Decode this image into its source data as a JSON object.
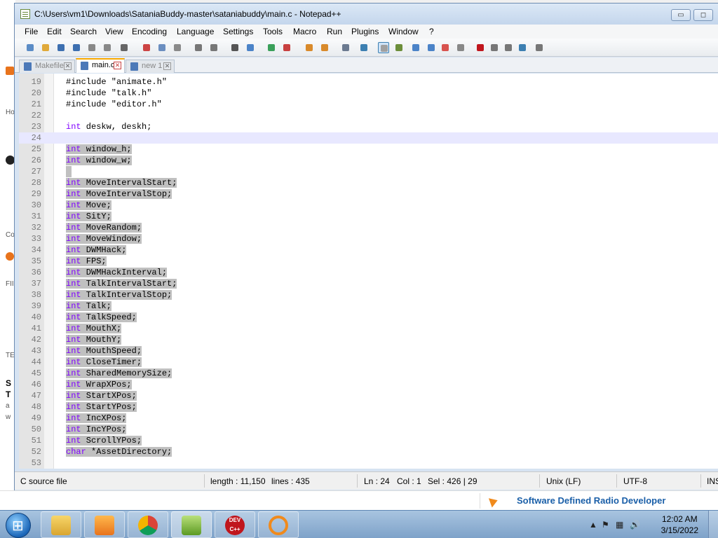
{
  "window": {
    "title": "C:\\Users\\vm1\\Downloads\\SataniaBuddy-master\\sataniabuddy\\main.c - Notepad++",
    "minimize": "▭",
    "maximize": "◻"
  },
  "menu": [
    "File",
    "Edit",
    "Search",
    "View",
    "Encoding",
    "Language",
    "Settings",
    "Tools",
    "Macro",
    "Run",
    "Plugins",
    "Window",
    "?"
  ],
  "toolbar_icons": [
    "new-file-icon",
    "open-file-icon",
    "save-icon",
    "save-all-icon",
    "close-icon",
    "close-all-icon",
    "print-icon",
    "cut-icon",
    "copy-icon",
    "paste-icon",
    "undo-icon",
    "redo-icon",
    "find-icon",
    "replace-icon",
    "zoom-in-icon",
    "zoom-out-icon",
    "sync-v-icon",
    "sync-h-icon",
    "word-wrap-icon",
    "show-all-chars-icon",
    "indent-guide-icon",
    "udl-icon",
    "doc-map-icon",
    "function-list-icon",
    "folder-workspace-icon",
    "monitor-icon",
    "record-macro-icon",
    "stop-macro-icon",
    "play-macro-icon",
    "run-macro-multi-icon",
    "save-macro-icon"
  ],
  "tabs": [
    {
      "label": "Makefile",
      "active": false
    },
    {
      "label": "main.c",
      "active": true
    },
    {
      "label": "new 1",
      "active": false
    }
  ],
  "editor": {
    "lines": [
      {
        "n": "19",
        "type": "inc",
        "text": "#include \"animate.h\""
      },
      {
        "n": "20",
        "type": "inc",
        "text": "#include \"talk.h\""
      },
      {
        "n": "21",
        "type": "inc",
        "text": "#include \"editor.h\""
      },
      {
        "n": "22",
        "type": "blank",
        "text": ""
      },
      {
        "n": "23",
        "type": "decl",
        "kw": "int",
        "rest": " deskw, deskh;"
      },
      {
        "n": "24",
        "type": "caret",
        "text": ""
      },
      {
        "n": "25",
        "type": "decl",
        "kw": "int",
        "rest": " window_h;",
        "selected": true
      },
      {
        "n": "26",
        "type": "decl",
        "kw": "int",
        "rest": " window_w;",
        "selected": true
      },
      {
        "n": "27",
        "type": "blank",
        "text": "",
        "selected": true
      },
      {
        "n": "28",
        "type": "decl",
        "kw": "int",
        "rest": " MoveIntervalStart;",
        "selected": true
      },
      {
        "n": "29",
        "type": "decl",
        "kw": "int",
        "rest": " MoveIntervalStop;",
        "selected": true
      },
      {
        "n": "30",
        "type": "decl",
        "kw": "int",
        "rest": " Move;",
        "selected": true
      },
      {
        "n": "31",
        "type": "decl",
        "kw": "int",
        "rest": " SitY;",
        "selected": true
      },
      {
        "n": "32",
        "type": "decl",
        "kw": "int",
        "rest": " MoveRandom;",
        "selected": true
      },
      {
        "n": "33",
        "type": "decl",
        "kw": "int",
        "rest": " MoveWindow;",
        "selected": true
      },
      {
        "n": "34",
        "type": "decl",
        "kw": "int",
        "rest": " DWMHack;",
        "selected": true
      },
      {
        "n": "35",
        "type": "decl",
        "kw": "int",
        "rest": " FPS;",
        "selected": true
      },
      {
        "n": "36",
        "type": "decl",
        "kw": "int",
        "rest": " DWMHackInterval;",
        "selected": true
      },
      {
        "n": "37",
        "type": "decl",
        "kw": "int",
        "rest": " TalkIntervalStart;",
        "selected": true
      },
      {
        "n": "38",
        "type": "decl",
        "kw": "int",
        "rest": " TalkIntervalStop;",
        "selected": true
      },
      {
        "n": "39",
        "type": "decl",
        "kw": "int",
        "rest": " Talk;",
        "selected": true
      },
      {
        "n": "40",
        "type": "decl",
        "kw": "int",
        "rest": " TalkSpeed;",
        "selected": true
      },
      {
        "n": "41",
        "type": "decl",
        "kw": "int",
        "rest": " MouthX;",
        "selected": true
      },
      {
        "n": "42",
        "type": "decl",
        "kw": "int",
        "rest": " MouthY;",
        "selected": true
      },
      {
        "n": "43",
        "type": "decl",
        "kw": "int",
        "rest": " MouthSpeed;",
        "selected": true
      },
      {
        "n": "44",
        "type": "decl",
        "kw": "int",
        "rest": " CloseTimer;",
        "selected": true
      },
      {
        "n": "45",
        "type": "decl",
        "kw": "int",
        "rest": " SharedMemorySize;",
        "selected": true
      },
      {
        "n": "46",
        "type": "decl",
        "kw": "int",
        "rest": " WrapXPos;",
        "selected": true
      },
      {
        "n": "47",
        "type": "decl",
        "kw": "int",
        "rest": " StartXPos;",
        "selected": true
      },
      {
        "n": "48",
        "type": "decl",
        "kw": "int",
        "rest": " StartYPos;",
        "selected": true
      },
      {
        "n": "49",
        "type": "decl",
        "kw": "int",
        "rest": " IncXPos;",
        "selected": true
      },
      {
        "n": "50",
        "type": "decl",
        "kw": "int",
        "rest": " IncYPos;",
        "selected": true
      },
      {
        "n": "51",
        "type": "decl",
        "kw": "int",
        "rest": " ScrollYPos;",
        "selected": true
      },
      {
        "n": "52",
        "type": "ptr",
        "kw": "char",
        "rest": " *AssetDirectory;",
        "selected": true
      },
      {
        "n": "53",
        "type": "blank",
        "text": ""
      }
    ]
  },
  "status": {
    "lang": "C source file",
    "length": "length : 11,150",
    "lines": "lines : 435",
    "ln": "Ln : 24",
    "col": "Col : 1",
    "sel": "Sel : 426 | 29",
    "eol": "Unix (LF)",
    "enc": "UTF-8",
    "ins": "INS"
  },
  "background_page": {
    "frags": [
      "Ho",
      "Co",
      "FII",
      "TE",
      "S",
      "T",
      "a",
      "w"
    ],
    "ad_text": "Software Defined Radio Developer"
  },
  "taskbar": {
    "apps": [
      "explorer",
      "media-player",
      "chrome",
      "notepad-plus-plus",
      "dev-cpp",
      "search-tool"
    ],
    "devcpp_label": "DEV C++",
    "time": "12:02 AM",
    "date": "3/15/2022"
  },
  "colors": {
    "keyword": "#8000ff",
    "selection": "#c0c0c0",
    "active_tab_accent": "#f8a800"
  }
}
